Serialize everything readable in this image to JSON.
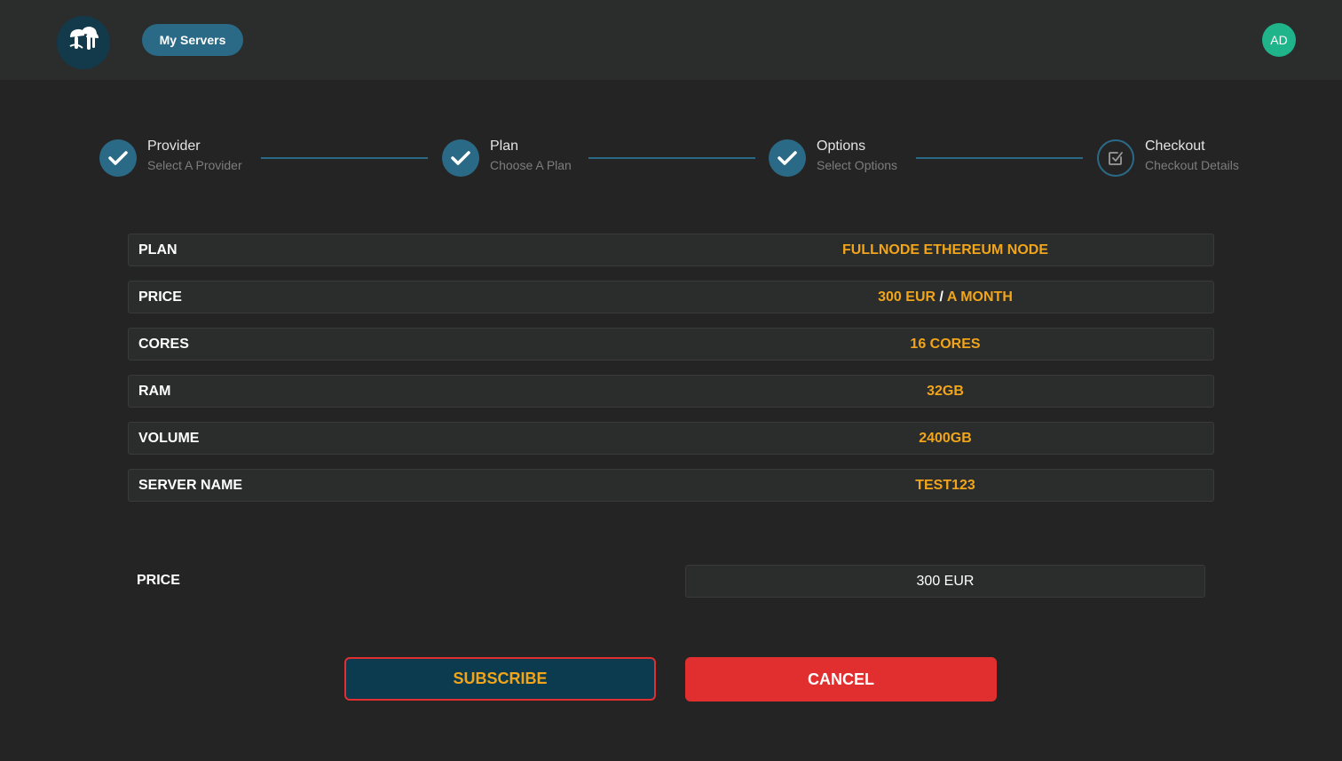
{
  "header": {
    "logo_icon": "mushroom-logo-icon",
    "nav_button": "My Servers",
    "avatar_initials": "AD"
  },
  "stepper": {
    "steps": [
      {
        "title": "Provider",
        "subtitle": "Select A Provider",
        "status": "done",
        "icon": "check-icon"
      },
      {
        "title": "Plan",
        "subtitle": "Choose A Plan",
        "status": "done",
        "icon": "check-icon"
      },
      {
        "title": "Options",
        "subtitle": "Select Options",
        "status": "done",
        "icon": "check-icon"
      },
      {
        "title": "Checkout",
        "subtitle": "Checkout Details",
        "status": "current",
        "icon": "checkbox-icon"
      }
    ]
  },
  "summary": {
    "rows": [
      {
        "label": "PLAN",
        "value": "FULLNODE ETHEREUM NODE"
      },
      {
        "label": "PRICE",
        "value": "300 EUR",
        "separator": "/",
        "value_suffix": "A MONTH"
      },
      {
        "label": "CORES",
        "value": "16 CORES"
      },
      {
        "label": "RAM",
        "value": "32GB"
      },
      {
        "label": "VOLUME",
        "value": "2400GB"
      },
      {
        "label": "SERVER NAME",
        "value": "TEST123"
      }
    ]
  },
  "total": {
    "label": "PRICE",
    "value": "300 EUR"
  },
  "actions": {
    "subscribe": "SUBSCRIBE",
    "cancel": "CANCEL"
  },
  "colors": {
    "background": "#242424",
    "panel": "#2b2c2c",
    "accent_blue": "#2b6a86",
    "value_orange": "#f1a51a",
    "danger_red": "#e12f2f",
    "avatar_green": "#1fb48a"
  }
}
